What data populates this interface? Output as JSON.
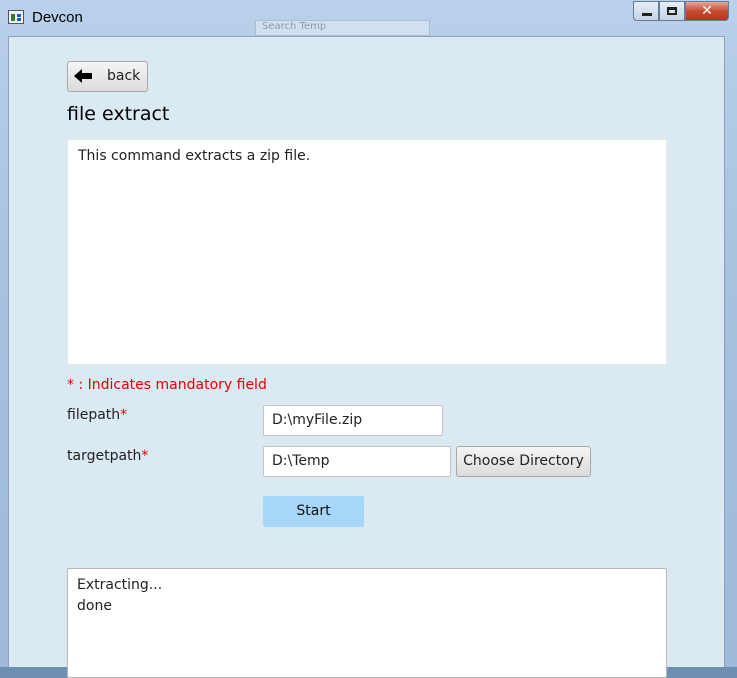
{
  "window": {
    "title": "Devcon",
    "background_search_placeholder": "Search Temp"
  },
  "toolbar": {
    "back_label": "back"
  },
  "page": {
    "heading": "file extract",
    "description": "This command extracts a zip file.",
    "mandatory_note": "* : Indicates mandatory field",
    "required_marker": "*"
  },
  "fields": {
    "filepath": {
      "label": "filepath",
      "value": "D:\\myFile.zip"
    },
    "targetpath": {
      "label": "targetpath",
      "value": "D:\\Temp"
    }
  },
  "actions": {
    "choose_directory_label": "Choose Directory",
    "start_label": "Start"
  },
  "log": {
    "lines": [
      "Extracting...",
      "done"
    ]
  },
  "colors": {
    "required": "#e60000",
    "start_button": "#a6d6f8",
    "client_background": "#dbe9f3"
  }
}
